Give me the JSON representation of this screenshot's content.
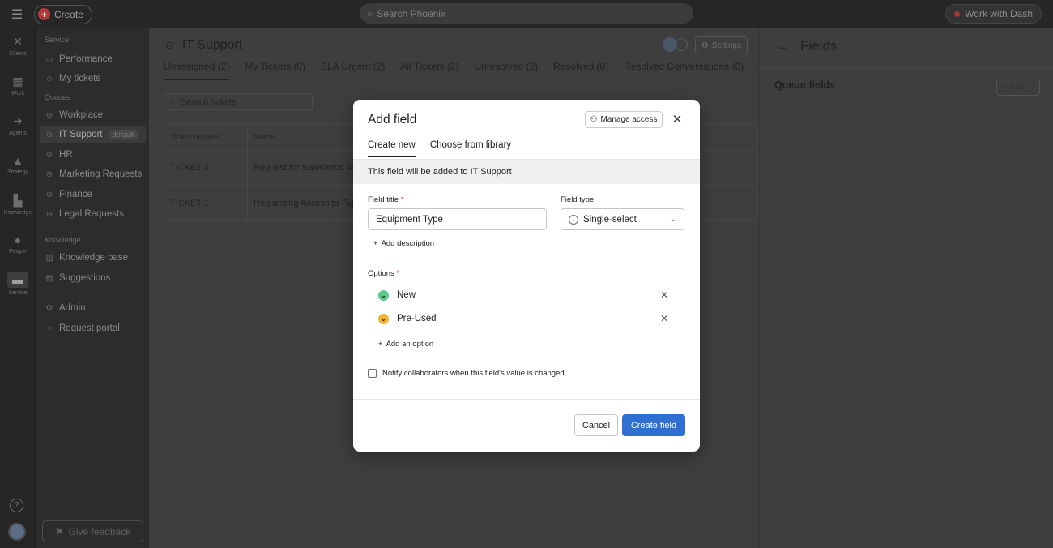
{
  "topbar": {
    "create_label": "Create",
    "search_placeholder": "Search Phoenix",
    "dash_label": "Work with Dash"
  },
  "rail": {
    "items": [
      {
        "label": "Clients",
        "icon": "clients-icon"
      },
      {
        "label": "Work",
        "icon": "work-icon"
      },
      {
        "label": "Agents",
        "icon": "agents-icon"
      },
      {
        "label": "Strategy",
        "icon": "strategy-icon"
      },
      {
        "label": "Knowledge",
        "icon": "knowledge-icon"
      },
      {
        "label": "People",
        "icon": "people-icon"
      },
      {
        "label": "Service",
        "icon": "service-icon"
      }
    ]
  },
  "sidebar": {
    "service_section": "Service",
    "performance": "Performance",
    "my_tickets": "My tickets",
    "queues_section": "Queues",
    "workplace": "Workplace",
    "it_support": "IT Support",
    "default_badge": "default",
    "hr": "HR",
    "marketing": "Marketing Requests",
    "finance": "Finance",
    "legal": "Legal Requests",
    "knowledge_section": "Knowledge",
    "knowledge_base": "Knowledge base",
    "suggestions": "Suggestions",
    "admin": "Admin",
    "request_portal": "Request portal",
    "feedback": "Give feedback"
  },
  "main": {
    "title": "IT Support",
    "settings_label": "Settings",
    "tabs": [
      "Unassigned (2)",
      "My Tickets (0)",
      "SLA Urgent (2)",
      "All Tickets (2)",
      "Unresolved (2)",
      "Resolved (0)",
      "Resolved Conversations (0)"
    ],
    "search_placeholder": "Search tickets",
    "table": {
      "headers": [
        "Ticket number",
        "Name"
      ],
      "rows": [
        [
          "TICKET-2",
          "Request for Salesforce Ac"
        ],
        [
          "TICKET-1",
          "Requesting Access to Fig"
        ]
      ]
    }
  },
  "rpanel": {
    "title": "Fields",
    "subtitle": "Queue fields",
    "add_label": "Add"
  },
  "modal": {
    "title": "Add field",
    "manage_access": "Manage access",
    "tabs": [
      "Create new",
      "Choose from library"
    ],
    "banner": "This field will be added to IT Support",
    "field_title_label": "Field title",
    "field_title_value": "Equipment Type",
    "field_type_label": "Field type",
    "field_type_value": "Single-select",
    "add_description": "Add description",
    "options_label": "Options",
    "options": [
      {
        "label": "New",
        "color": "#5dc98b"
      },
      {
        "label": "Pre-Used",
        "color": "#f1b534"
      }
    ],
    "add_option": "Add an option",
    "notify_label": "Notify collaborators when this field's value is changed",
    "cancel": "Cancel",
    "create": "Create field"
  }
}
